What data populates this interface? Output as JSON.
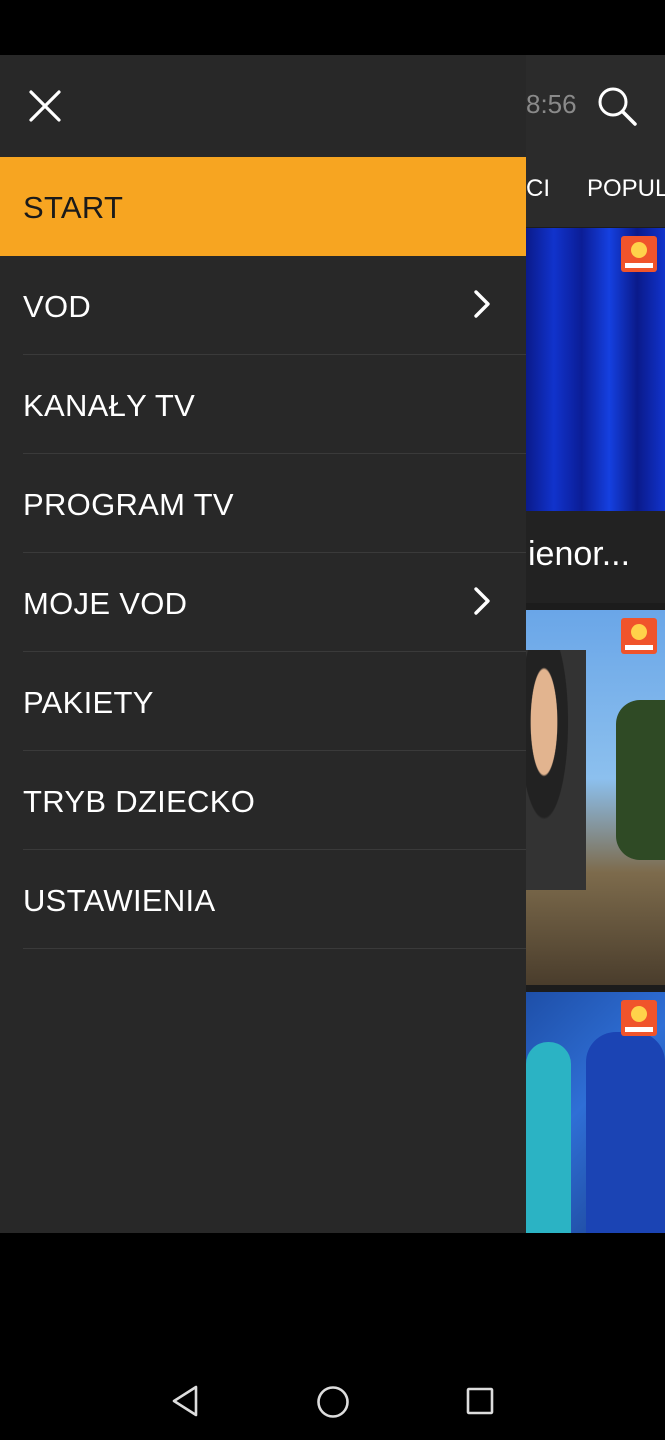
{
  "drawer": {
    "items": [
      {
        "label": "START",
        "active": true,
        "has_arrow": false
      },
      {
        "label": "VOD",
        "active": false,
        "has_arrow": true
      },
      {
        "label": "KANAŁY TV",
        "active": false,
        "has_arrow": false
      },
      {
        "label": "PROGRAM TV",
        "active": false,
        "has_arrow": false
      },
      {
        "label": "MOJE VOD",
        "active": false,
        "has_arrow": true
      },
      {
        "label": "PAKIETY",
        "active": false,
        "has_arrow": false
      },
      {
        "label": "TRYB DZIECKO",
        "active": false,
        "has_arrow": false
      },
      {
        "label": "USTAWIENIA",
        "active": false,
        "has_arrow": false
      }
    ]
  },
  "background": {
    "time": "8:56",
    "tabs": [
      "CI",
      "POPUL"
    ],
    "card_caption": "ienor..."
  },
  "colors": {
    "accent": "#f7a521",
    "drawer_bg": "#282828"
  },
  "icons": {
    "close": "close-icon",
    "search": "search-icon",
    "chevron": "chevron-right-icon",
    "badge": "polsat-logo-icon"
  }
}
